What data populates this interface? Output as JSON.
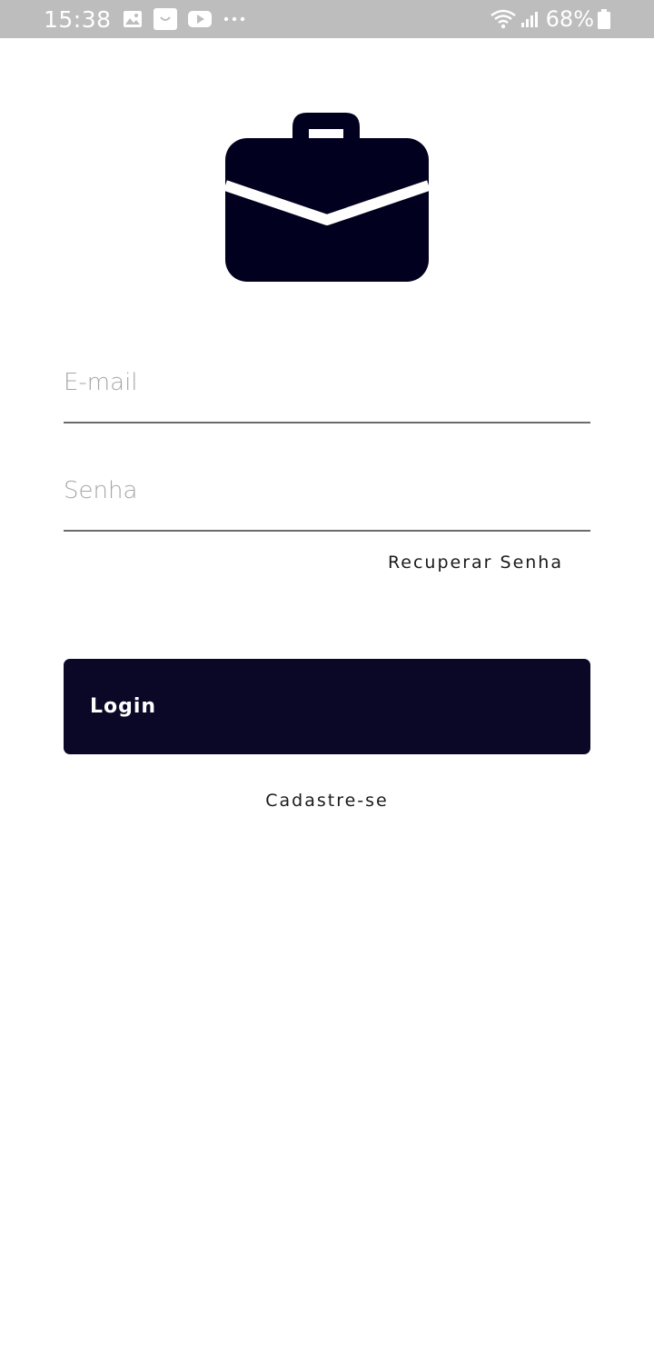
{
  "status_bar": {
    "time": "15:38",
    "battery": "68%",
    "left_icons": [
      "gallery-icon",
      "smile-notification-icon",
      "youtube-icon",
      "more-dots-icon"
    ],
    "right_icons": [
      "wifi-icon",
      "signal-icon",
      "battery-icon"
    ]
  },
  "logo": {
    "icon": "briefcase-icon",
    "color": "#02001f"
  },
  "form": {
    "email_placeholder": "E-mail",
    "password_placeholder": "Senha",
    "recover_label": "Recuperar Senha",
    "login_label": "Login",
    "signup_label": "Cadastre-se"
  },
  "colors": {
    "primary": "#0a0826",
    "status_bar": "#bdbdbd",
    "placeholder": "#a6a6a6",
    "underline": "#6b6b6b"
  }
}
